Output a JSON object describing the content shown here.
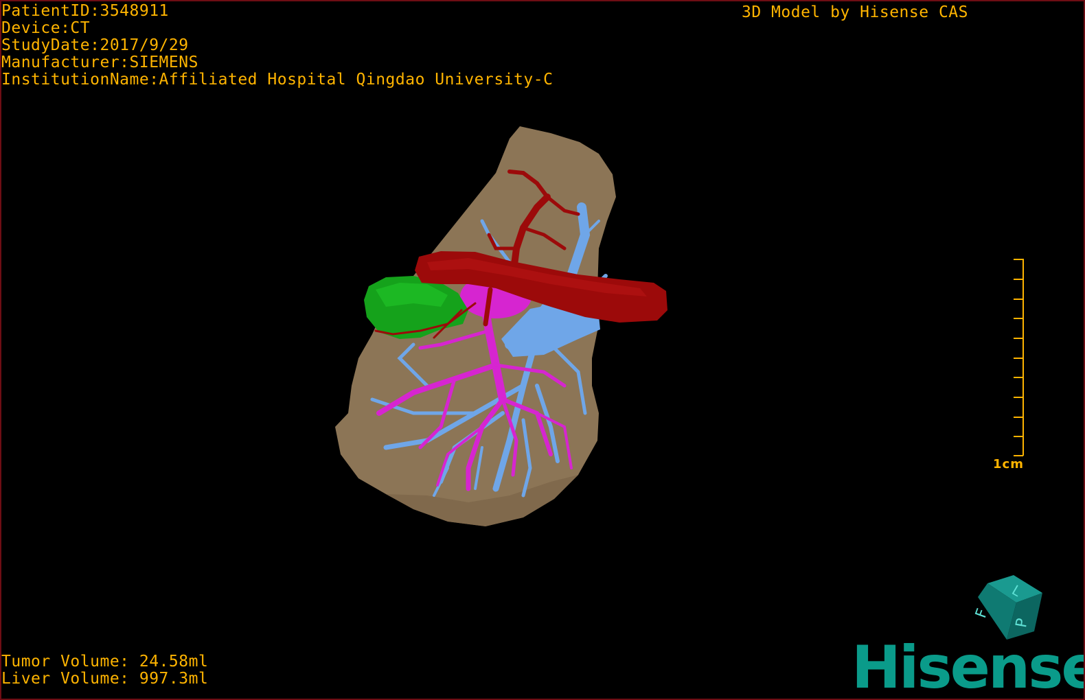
{
  "overlay": {
    "patient_id": "PatientID:3548911",
    "device": "Device:CT",
    "study_date": "StudyDate:2017/9/29",
    "manufacturer": "Manufacturer:SIEMENS",
    "institution": "InstitutionName:Affiliated Hospital Qingdao University-C",
    "model_credit": "3D Model by Hisense CAS",
    "tumor_volume": "Tumor Volume: 24.58ml",
    "liver_volume": "Liver Volume: 997.3ml"
  },
  "scale_bar": {
    "label": "1cm"
  },
  "orientation_cube": {
    "face_labels": [
      "F",
      "L",
      "P"
    ]
  },
  "brand": {
    "logo_text": "Hisense"
  },
  "colors": {
    "overlay_text": "#ffb400",
    "liver": "#8c7556",
    "tumor": "#15a21b",
    "artery": "#9c0a0a",
    "portal_vein": "#d625d0",
    "hepatic_vein": "#6fa6e8",
    "cube": "#0f7a72",
    "brand": "#0a9b8a",
    "frame": "#6e0d14"
  }
}
